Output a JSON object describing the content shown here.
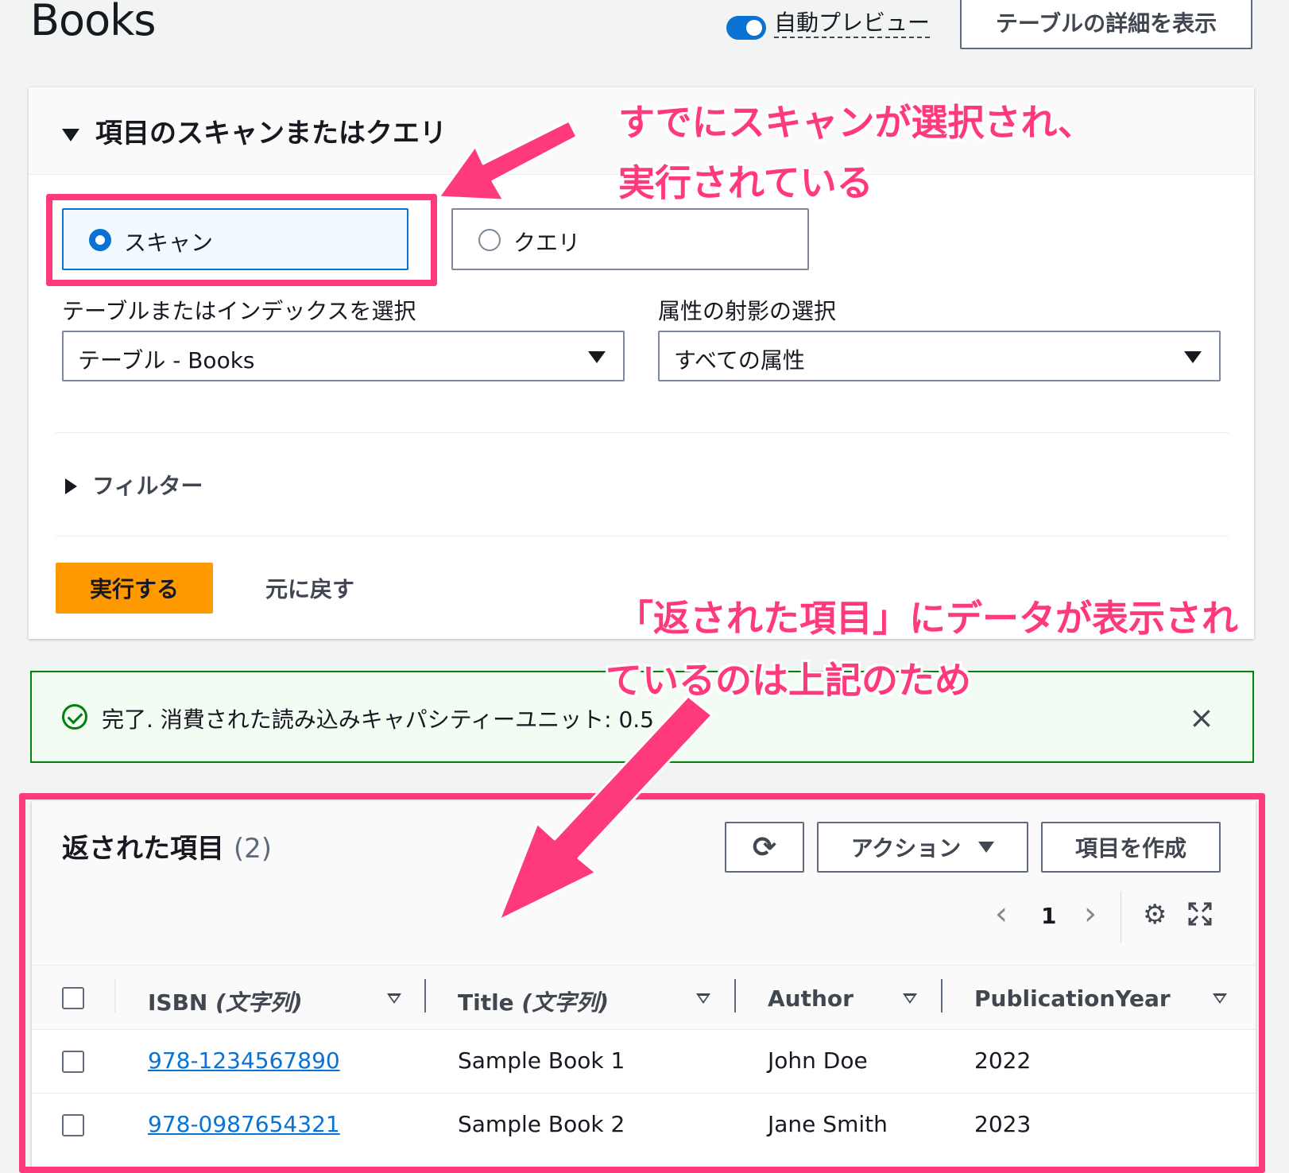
{
  "header": {
    "title": "Books",
    "auto_preview_label": "自動プレビュー",
    "auto_preview_on": true,
    "details_button": "テーブルの詳細を表示"
  },
  "scan_query_panel": {
    "title": "項目のスキャンまたはクエリ",
    "options": [
      {
        "label": "スキャン",
        "selected": true
      },
      {
        "label": "クエリ",
        "selected": false
      }
    ],
    "table_select": {
      "label": "テーブルまたはインデックスを選択",
      "value": "テーブル - Books"
    },
    "projection_select": {
      "label": "属性の射影の選択",
      "value": "すべての属性"
    },
    "filter_label": "フィルター",
    "run_button": "実行する",
    "reset_button": "元に戻す"
  },
  "flash": {
    "message": "完了. 消費された読み込みキャパシティーユニット: 0.5",
    "close_icon": "×"
  },
  "results": {
    "title": "返された項目",
    "count": "(2)",
    "refresh_icon": "⟳",
    "actions_button": "アクション",
    "create_button": "項目を作成",
    "pagination": {
      "prev": "‹",
      "page": "1",
      "next": "›"
    },
    "settings_icon": "⚙",
    "columns": [
      {
        "name": "ISBN",
        "type": "(文字列)"
      },
      {
        "name": "Title",
        "type": "(文字列)"
      },
      {
        "name": "Author",
        "type": ""
      },
      {
        "name": "PublicationYear",
        "type": ""
      }
    ],
    "rows": [
      {
        "isbn": "978-1234567890",
        "title": "Sample Book 1",
        "author": "John Doe",
        "year": "2022"
      },
      {
        "isbn": "978-0987654321",
        "title": "Sample Book 2",
        "author": "Jane Smith",
        "year": "2023"
      }
    ]
  },
  "annotations": {
    "top_line1": "すでにスキャンが選択され、",
    "top_line2": "実行されている",
    "bottom_line1": "「返された項目」にデータが表示され",
    "bottom_line2": "ているのは上記のため"
  },
  "colors": {
    "accent": "#0972d3",
    "run_button": "#ff9900",
    "success": "#037f0c",
    "annotation": "#ff3a7a"
  }
}
